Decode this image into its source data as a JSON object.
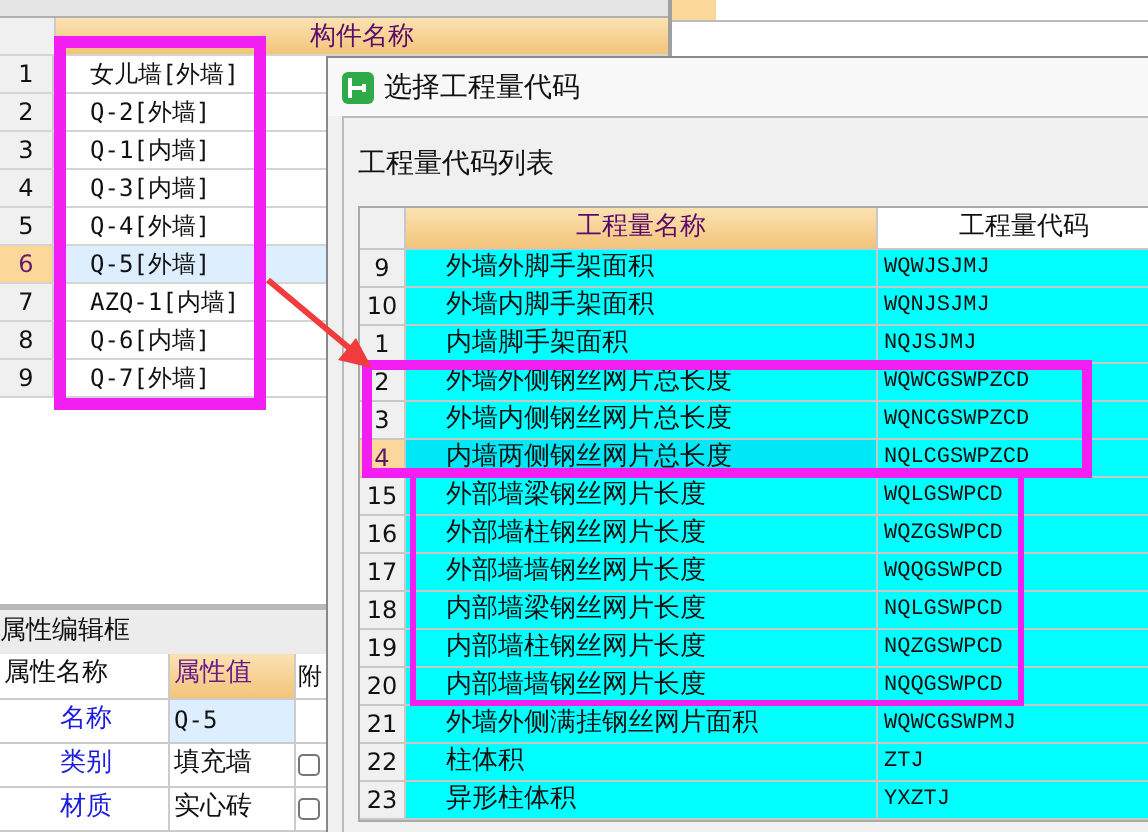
{
  "component_table": {
    "column": "构件名称",
    "rows": [
      {
        "num": "1",
        "name": "女儿墙[外墙]",
        "selected": false
      },
      {
        "num": "2",
        "name": "Q-2[外墙]",
        "selected": false
      },
      {
        "num": "3",
        "name": "Q-1[内墙]",
        "selected": false
      },
      {
        "num": "4",
        "name": "Q-3[内墙]",
        "selected": false
      },
      {
        "num": "5",
        "name": "Q-4[外墙]",
        "selected": false
      },
      {
        "num": "6",
        "name": "Q-5[外墙]",
        "selected": true
      },
      {
        "num": "7",
        "name": "AZQ-1[内墙]",
        "selected": false
      },
      {
        "num": "8",
        "name": "Q-6[内墙]",
        "selected": false
      },
      {
        "num": "9",
        "name": "Q-7[外墙]",
        "selected": false
      }
    ]
  },
  "properties": {
    "title": "属性编辑框",
    "columns": [
      "属性名称",
      "属性值",
      "附"
    ],
    "rows": [
      {
        "name": "名称",
        "value": "Q-5",
        "kind": "text"
      },
      {
        "name": "类别",
        "value": "填充墙",
        "kind": "checkbox",
        "checked": false
      },
      {
        "name": "材质",
        "value": "实心砖",
        "kind": "checkbox",
        "checked": false
      }
    ]
  },
  "dialog": {
    "title": "选择工程量代码",
    "list_label": "工程量代码列表",
    "columns": [
      "工程量名称",
      "工程量代码"
    ],
    "rows": [
      {
        "num": "9",
        "name": "外墙外脚手架面积",
        "code": "WQWJSJMJ",
        "selected": false
      },
      {
        "num": "10",
        "name": "外墙内脚手架面积",
        "code": "WQNJSJMJ",
        "selected": false
      },
      {
        "num": "1",
        "name": "内墙脚手架面积",
        "code": "NQJSJMJ",
        "selected": false
      },
      {
        "num": "2",
        "name": "外墙外侧钢丝网片总长度",
        "code": "WQWCGSWPZCD",
        "selected": false
      },
      {
        "num": "3",
        "name": "外墙内侧钢丝网片总长度",
        "code": "WQNCGSWPZCD",
        "selected": false
      },
      {
        "num": "4",
        "name": "内墙两侧钢丝网片总长度",
        "code": "NQLCGSWPZCD",
        "selected": true
      },
      {
        "num": "15",
        "name": "外部墙梁钢丝网片长度",
        "code": "WQLGSWPCD",
        "selected": false
      },
      {
        "num": "16",
        "name": "外部墙柱钢丝网片长度",
        "code": "WQZGSWPCD",
        "selected": false
      },
      {
        "num": "17",
        "name": "外部墙墙钢丝网片长度",
        "code": "WQQGSWPCD",
        "selected": false
      },
      {
        "num": "18",
        "name": "内部墙梁钢丝网片长度",
        "code": "NQLGSWPCD",
        "selected": false
      },
      {
        "num": "19",
        "name": "内部墙柱钢丝网片长度",
        "code": "NQZGSWPCD",
        "selected": false
      },
      {
        "num": "20",
        "name": "内部墙墙钢丝网片长度",
        "code": "NQQGSWPCD",
        "selected": false
      },
      {
        "num": "21",
        "name": "外墙外侧满挂钢丝网片面积",
        "code": "WQWCGSWPMJ",
        "selected": false
      },
      {
        "num": "22",
        "name": "柱体积",
        "code": "ZTJ",
        "selected": false
      },
      {
        "num": "23",
        "name": "异形柱体积",
        "code": "YXZTJ",
        "selected": false
      }
    ]
  }
}
